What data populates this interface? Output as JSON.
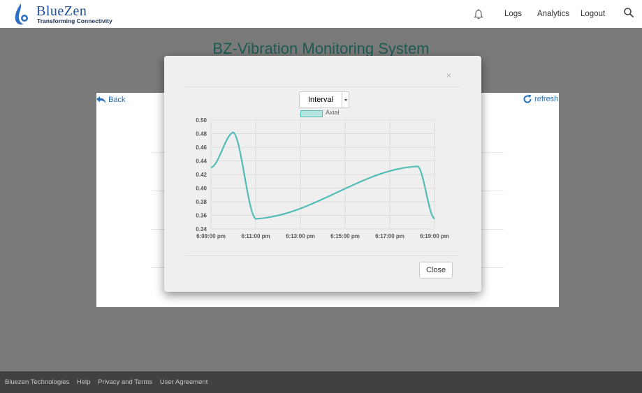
{
  "header": {
    "logo": {
      "name": "BlueZen",
      "tagline": "Transforming Connectivity"
    },
    "nav": [
      "Logs",
      "Analytics",
      "Logout"
    ],
    "icons": {
      "bell": "bell-icon",
      "search": "search-icon"
    }
  },
  "page": {
    "title": "BZ-Vibration Monitoring System",
    "back_label": "Back",
    "refresh_label": "refresh"
  },
  "modal": {
    "close_symbol": "×",
    "select_value": "Interval",
    "close_button": "Close"
  },
  "chart_data": {
    "type": "line",
    "series": [
      {
        "name": "Axial",
        "color": "#52bcb6",
        "points": [
          {
            "x": "6:09:00 pm",
            "y": 0.43
          },
          {
            "x": "6:10:00 pm",
            "y": 0.482
          },
          {
            "x": "6:11:00 pm",
            "y": 0.355
          },
          {
            "x": "6:18:15 pm",
            "y": 0.432
          },
          {
            "x": "6:19:00 pm",
            "y": 0.355
          }
        ]
      }
    ],
    "x_ticks": [
      "6:09:00 pm",
      "6:11:00 pm",
      "6:13:00 pm",
      "6:15:00 pm",
      "6:17:00 pm",
      "6:19:00 pm"
    ],
    "y_ticks": [
      "0.34",
      "0.36",
      "0.38",
      "0.40",
      "0.42",
      "0.44",
      "0.46",
      "0.48",
      "0.50"
    ],
    "ylim": [
      0.34,
      0.5
    ],
    "xlim": [
      "6:09:00 pm",
      "6:19:00 pm"
    ],
    "grid": true,
    "legend": "top"
  },
  "footer": {
    "items": [
      "Bluezen Technologies",
      "Help",
      "Privacy and Terms",
      "User Agreement"
    ]
  },
  "colors": {
    "brand": "#1f4f94",
    "title": "#1c5a52",
    "link": "#2a6fb7",
    "series": "#52bcb6"
  }
}
